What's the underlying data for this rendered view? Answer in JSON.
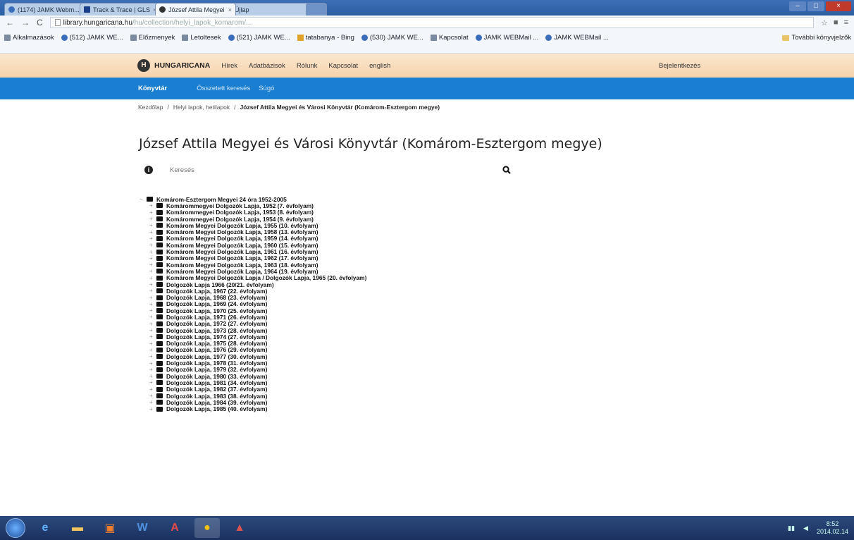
{
  "browser": {
    "tabs": [
      {
        "label": "(1174) JAMK Webm...",
        "active": false
      },
      {
        "label": "Track & Trace | GLS",
        "active": false
      },
      {
        "label": "József Attila Megyei",
        "active": true
      },
      {
        "label": "Újlap",
        "active": false
      }
    ],
    "url": {
      "host": "library.hungaricana.hu",
      "path": "/hu/collection/helyi_lapok_komarom/..."
    },
    "bookmarks": [
      {
        "label": "Alkalmazások",
        "icon": "apps-icon"
      },
      {
        "label": "(512) JAMK WE...",
        "icon": "mail-icon"
      },
      {
        "label": "Előzmenyek",
        "icon": "history-icon"
      },
      {
        "label": "Letoltesek",
        "icon": "download-icon"
      },
      {
        "label": "(521) JAMK WE...",
        "icon": "mail-icon"
      },
      {
        "label": "tatabanya - Bing",
        "icon": "bing-icon"
      },
      {
        "label": "(530) JAMK WE...",
        "icon": "mail-icon"
      },
      {
        "label": "Kapcsolat",
        "icon": "page-icon"
      },
      {
        "label": "JAMK WEBMail ...",
        "icon": "mail-icon"
      },
      {
        "label": "JAMK WEBMail ...",
        "icon": "mail-icon"
      }
    ],
    "other_bookmarks": "További könyvjelzők"
  },
  "site": {
    "logo": "HUNGARICANA",
    "menu": [
      "Hírek",
      "Adatbázisok",
      "Rólunk",
      "Kapcsolat",
      "english"
    ],
    "login": "Bejelentkezés",
    "section": "Könyvtár",
    "subnav": [
      "Összetett keresés",
      "Súgó"
    ],
    "breadcrumb": [
      "Kezdőlap",
      "Helyi lapok, hetilapok",
      "József Attila Megyei és Városi Könyvtár (Komárom-Esztergom megye)"
    ],
    "page_title": "József Attila Megyei és Városi Könyvtár (Komárom-Esztergom megye)",
    "search_placeholder": "Keresés"
  },
  "tree": {
    "root": "Komárom-Esztergom Megyei 24 óra 1952-2005",
    "children": [
      "Komárommegyei Dolgozók Lapja, 1952 (7. évfolyam)",
      "Komárommegyei Dolgozók Lapja, 1953 (8. évfolyam)",
      "Komárommegyei Dolgozók Lapja, 1954 (9. évfolyam)",
      "Komárom Megyei Dolgozók Lapja, 1955 (10. évfolyam)",
      "Komárom Megyei Dolgozók Lapja, 1958 (13. évfolyam)",
      "Komárom Megyei Dolgozók Lapja, 1959 (14. évfolyam)",
      "Komárom Megyei Dolgozók Lapja, 1960 (15. évfolyam)",
      "Komárom Megyei Dolgozók Lapja, 1961 (16. évfolyam)",
      "Komárom Megyei Dolgozók Lapja, 1962 (17. évfolyam)",
      "Komárom Megyei Dolgozók Lapja, 1963 (18. évfolyam)",
      "Komárom Megyei Dolgozók Lapja, 1964 (19. évfolyam)",
      "Komárom Megyei Dolgozók Lapja / Dolgozók Lapja, 1965 (20. évfolyam)",
      "Dolgozók Lapja 1966 (20/21. évfolyam)",
      "Dolgozók Lapja, 1967 (22. évfolyam)",
      "Dolgozók Lapja, 1968 (23. évfolyam)",
      "Dolgozók Lapja, 1969 (24. évfolyam)",
      "Dolgozók Lapja, 1970 (25. évfolyam)",
      "Dolgozók Lapja, 1971 (26. évfolyam)",
      "Dolgozók Lapja, 1972 (27. évfolyam)",
      "Dolgozók Lapja, 1973 (28. évfolyam)",
      "Dolgozók Lapja, 1974 (27. évfolyam)",
      "Dolgozók Lapja, 1975 (28. évfolyam)",
      "Dolgozók Lapja, 1976 (29. évfolyam)",
      "Dolgozók Lapja, 1977 (30. évfolyam)",
      "Dolgozók Lapja, 1978 (31. évfolyam)",
      "Dolgozók Lapja, 1979 (32. évfolyam)",
      "Dolgozók Lapja, 1980 (33. évfolyam)",
      "Dolgozók Lapja, 1981 (34. évfolyam)",
      "Dolgozók Lapja, 1982 (37. évfolyam)",
      "Dolgozók Lapja, 1983 (38. évfolyam)",
      "Dolgozók Lapja, 1984 (39. évfolyam)",
      "Dolgozók Lapja, 1985 (40. évfolyam)"
    ]
  },
  "taskbar": {
    "apps": [
      "windows-start-icon",
      "ie-icon",
      "file-explorer-icon",
      "outlook-icon",
      "word-icon",
      "acrobat-icon",
      "chrome-icon",
      "pdf-icon"
    ],
    "clock": {
      "time": "8:52",
      "date": "2014.02.14"
    }
  }
}
